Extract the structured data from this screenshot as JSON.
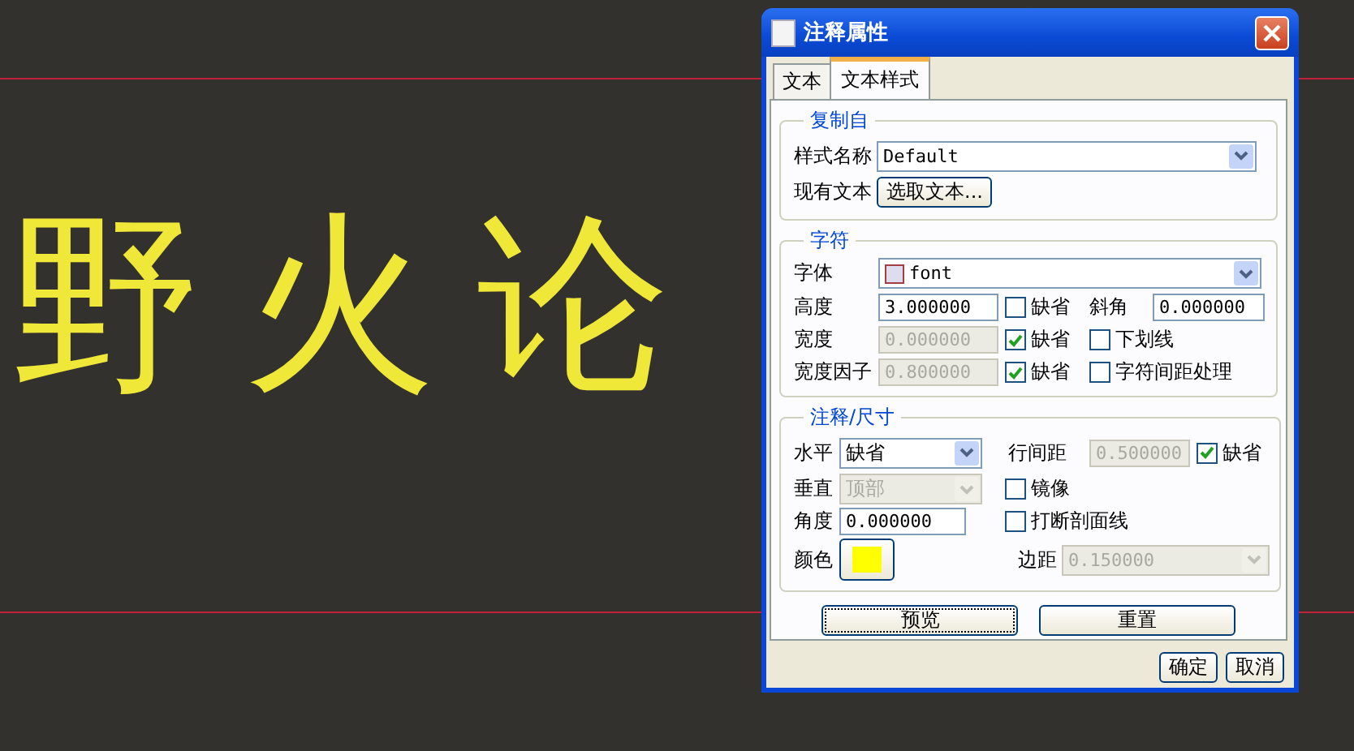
{
  "canvas": {
    "annotation_text": "野火论"
  },
  "dialog": {
    "title": "注释属性",
    "tabs": [
      {
        "label": "文本",
        "selected": false
      },
      {
        "label": "文本样式",
        "selected": true
      }
    ],
    "copy_from": {
      "legend": "复制自",
      "style_name": {
        "label": "样式名称",
        "value": "Default",
        "disabled": false
      },
      "existing_text_label": "现有文本",
      "select_text_button": "选取文本..."
    },
    "character": {
      "legend": "字符",
      "font": {
        "label": "字体",
        "value": "font",
        "disabled": false
      },
      "height": {
        "label": "高度",
        "value": "3.000000",
        "disabled": false
      },
      "height_default": {
        "label": "缺省",
        "checked": false
      },
      "slant": {
        "label": "斜角",
        "value": "0.000000",
        "disabled": false
      },
      "width": {
        "label": "宽度",
        "value": "0.000000",
        "disabled": true
      },
      "width_default": {
        "label": "缺省",
        "checked": true
      },
      "underline": {
        "label": "下划线",
        "checked": false
      },
      "width_factor": {
        "label": "宽度因子",
        "value": "0.800000",
        "disabled": true
      },
      "width_factor_default": {
        "label": "缺省",
        "checked": true
      },
      "kerning": {
        "label": "字符间距处理",
        "checked": false
      }
    },
    "annotation": {
      "legend": "注释/尺寸",
      "horizontal": {
        "label": "水平",
        "value": "缺省",
        "disabled": false
      },
      "line_spacing": {
        "label": "行间距",
        "value": "0.500000",
        "disabled": true
      },
      "line_spacing_default": {
        "label": "缺省",
        "checked": true
      },
      "vertical": {
        "label": "垂直",
        "value": "顶部",
        "disabled": true
      },
      "mirror": {
        "label": "镜像",
        "checked": false
      },
      "angle": {
        "label": "角度",
        "value": "0.000000",
        "disabled": false
      },
      "break_hatch": {
        "label": "打断剖面线",
        "checked": false
      },
      "color": {
        "label": "颜色",
        "color": "#ffff00"
      },
      "margin": {
        "label": "边距",
        "value": "0.150000",
        "disabled": true
      }
    },
    "preview_button": "预览",
    "reset_button": "重置",
    "ok_button": "确定",
    "cancel_button": "取消"
  }
}
